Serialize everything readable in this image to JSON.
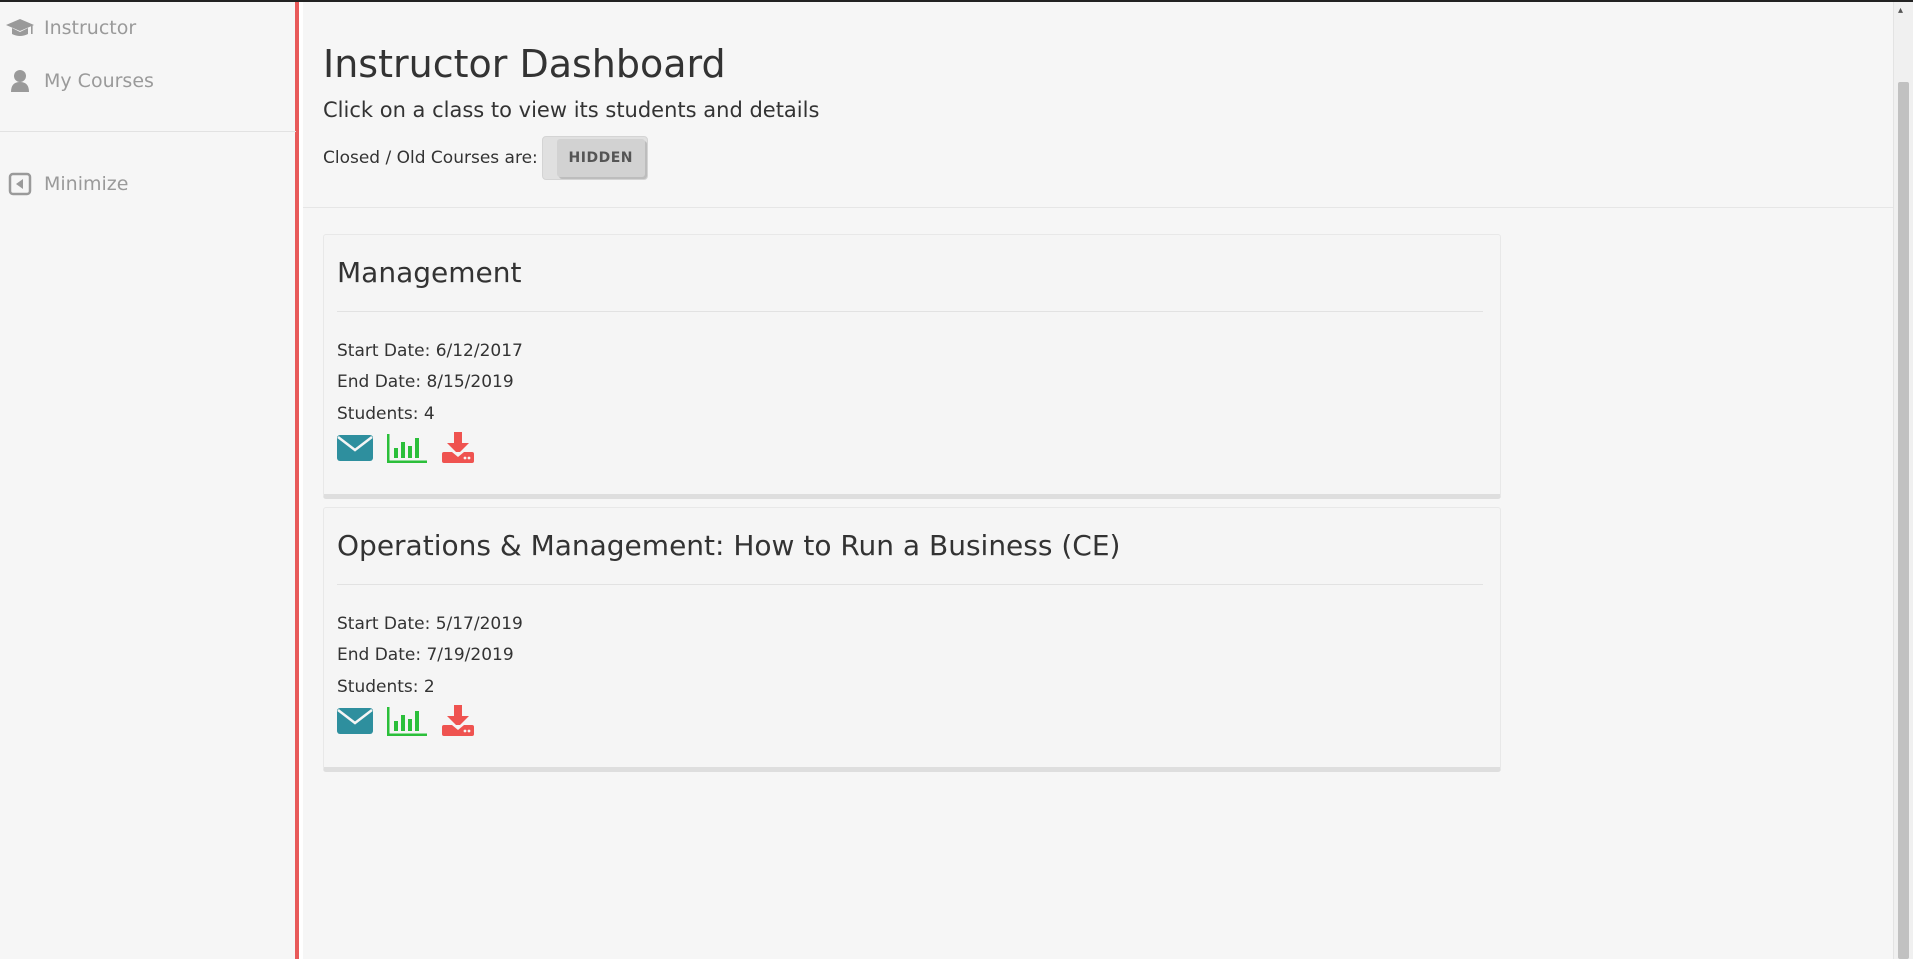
{
  "sidebar": {
    "items": [
      {
        "label": "Instructor",
        "icon": "graduation-cap-icon"
      },
      {
        "label": "My Courses",
        "icon": "user-icon"
      },
      {
        "label": "Minimize",
        "icon": "caret-left-square-icon"
      }
    ]
  },
  "header": {
    "title": "Instructor Dashboard",
    "subtitle": "Click on a class to view its students and details",
    "toggle_label": "Closed / Old Courses are:",
    "toggle_value": "HIDDEN"
  },
  "courses": [
    {
      "title": "Management",
      "start_date": "Start Date: 6/12/2017",
      "end_date": "End Date: 8/15/2019",
      "students": "Students: 4"
    },
    {
      "title": "Operations & Management: How to Run a Business (CE)",
      "start_date": "Start Date: 5/17/2019",
      "end_date": "End Date: 7/19/2019",
      "students": "Students: 2"
    }
  ],
  "colors": {
    "sidebar_accent": "#e85a5a",
    "email_icon": "#2e8f9e",
    "chart_icon": "#2bbf3a",
    "download_icon": "#ef5350"
  }
}
